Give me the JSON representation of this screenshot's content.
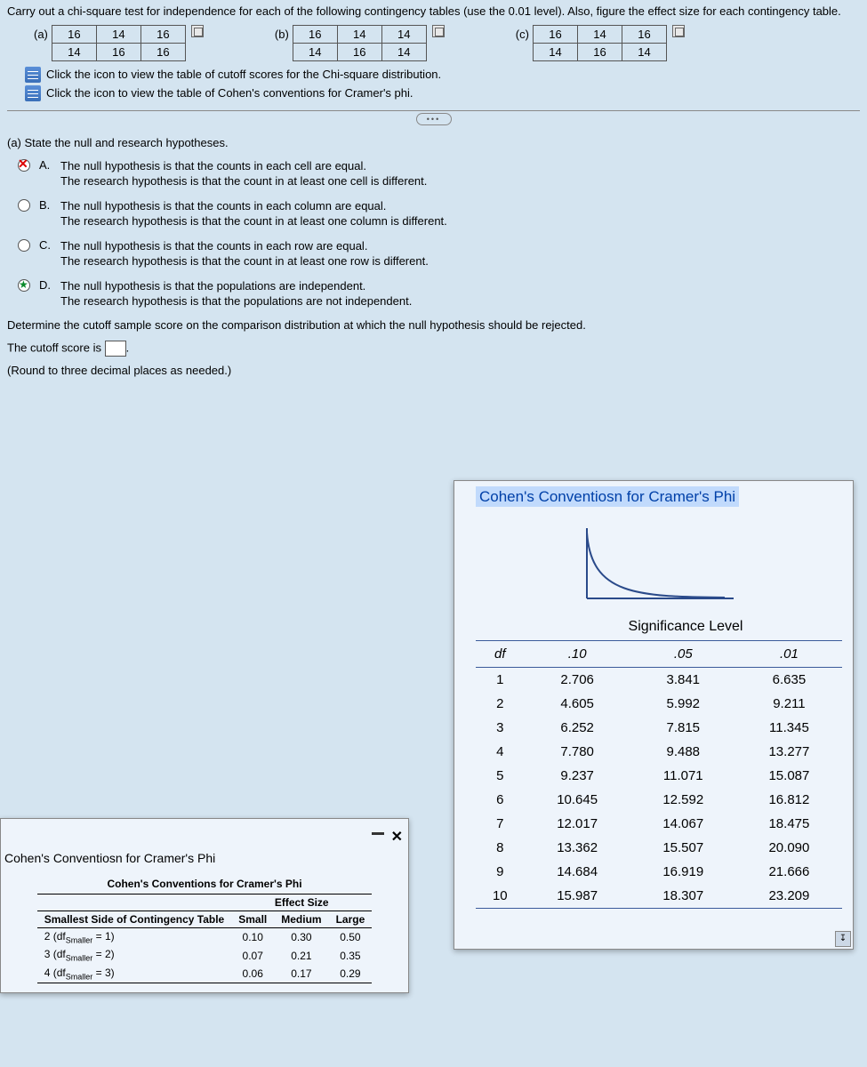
{
  "question": {
    "intro": "Carry out a chi-square test for independence for each of the following contingency tables (use the 0.01 level). Also, figure the effect size for each contingency table.",
    "tables": {
      "a": {
        "label": "(a)",
        "rows": [
          [
            "16",
            "14",
            "16"
          ],
          [
            "14",
            "16",
            "16"
          ]
        ]
      },
      "b": {
        "label": "(b)",
        "rows": [
          [
            "16",
            "14",
            "14"
          ],
          [
            "14",
            "16",
            "14"
          ]
        ]
      },
      "c": {
        "label": "(c)",
        "rows": [
          [
            "16",
            "14",
            "16"
          ],
          [
            "14",
            "16",
            "14"
          ]
        ]
      }
    },
    "link1": "Click the icon to view the table of cutoff scores for the Chi-square distribution.",
    "link2": "Click the icon to view the table of Cohen's conventions for Cramer's phi."
  },
  "partA": {
    "prompt": "(a) State the null and research hypotheses.",
    "options": {
      "A": {
        "line1": "The null hypothesis is that the counts in each cell are equal.",
        "line2": "The research hypothesis is that the count in at least one cell is different."
      },
      "B": {
        "line1": "The null hypothesis is that the counts in each column are equal.",
        "line2": "The research hypothesis is that the count in at least one column is different."
      },
      "C": {
        "line1": "The null hypothesis is that the counts in each row are equal.",
        "line2": "The research hypothesis is that the count in at least one row is different."
      },
      "D": {
        "line1": "The null hypothesis is that the populations are independent.",
        "line2": "The research hypothesis is that the populations are not independent."
      }
    }
  },
  "determine": "Determine the cutoff sample score on the comparison distribution at which the null hypothesis should be rejected.",
  "cutoff_text": "The cutoff score is",
  "cutoff_note": "(Round to three decimal places as needed.)",
  "cohenModal": {
    "title": "Cohen's Conventiosn for Cramer's Phi",
    "tableTitle": "Cohen's Conventions for Cramer's Phi",
    "colHeader": "Effect Size",
    "rowHeader": "Smallest Side of Contingency Table",
    "cols": [
      "Small",
      "Medium",
      "Large"
    ],
    "rows": [
      {
        "label": "2 (df",
        "sub": "Smaller",
        "eq": " = 1)",
        "vals": [
          "0.10",
          "0.30",
          "0.50"
        ]
      },
      {
        "label": "3 (df",
        "sub": "Smaller",
        "eq": " = 2)",
        "vals": [
          "0.07",
          "0.21",
          "0.35"
        ]
      },
      {
        "label": "4 (df",
        "sub": "Smaller",
        "eq": " = 3)",
        "vals": [
          "0.06",
          "0.17",
          "0.29"
        ]
      }
    ]
  },
  "chiModal": {
    "title": "Cohen's Conventiosn for Cramer's Phi",
    "sig": "Significance Level",
    "headers": [
      "df",
      ".10",
      ".05",
      ".01"
    ]
  },
  "chart_data": {
    "type": "table",
    "title": "Chi-square distribution cutoff scores",
    "columns": [
      "df",
      ".10",
      ".05",
      ".01"
    ],
    "rows": [
      [
        1,
        2.706,
        3.841,
        6.635
      ],
      [
        2,
        4.605,
        5.992,
        9.211
      ],
      [
        3,
        6.252,
        7.815,
        11.345
      ],
      [
        4,
        7.78,
        9.488,
        13.277
      ],
      [
        5,
        9.237,
        11.071,
        15.087
      ],
      [
        6,
        10.645,
        12.592,
        16.812
      ],
      [
        7,
        12.017,
        14.067,
        18.475
      ],
      [
        8,
        13.362,
        15.507,
        20.09
      ],
      [
        9,
        14.684,
        16.919,
        21.666
      ],
      [
        10,
        15.987,
        18.307,
        23.209
      ]
    ]
  }
}
